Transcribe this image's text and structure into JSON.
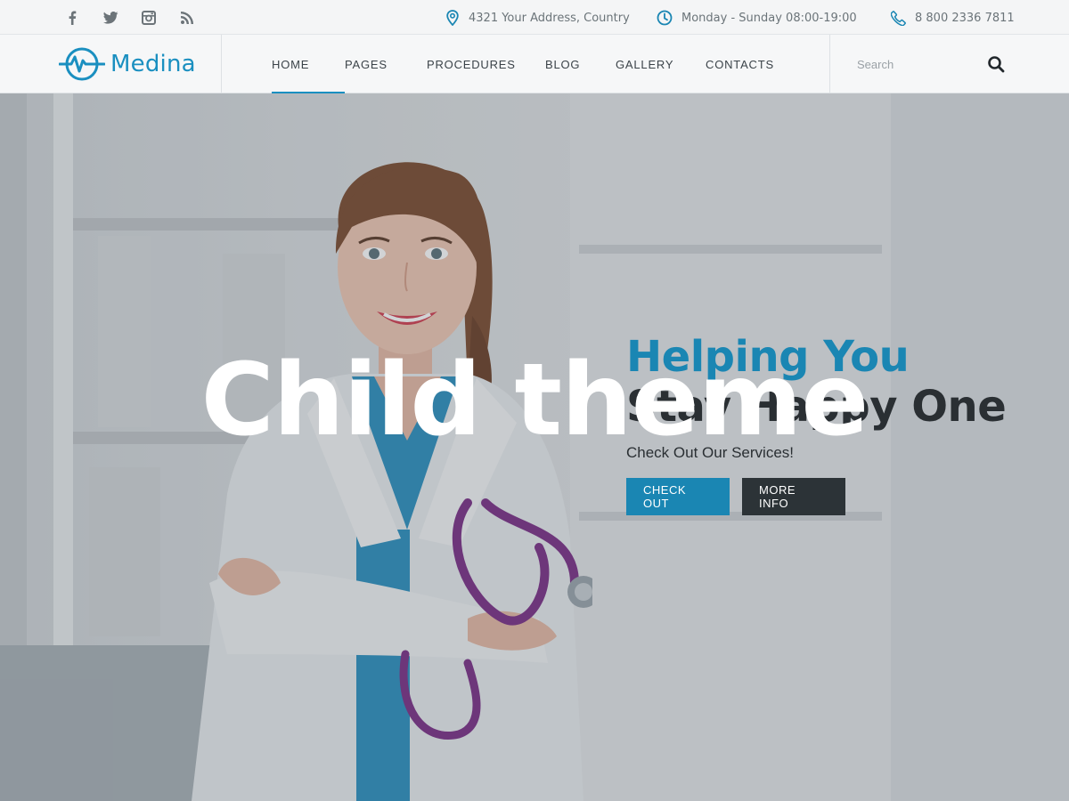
{
  "topbar": {
    "social": [
      "facebook-icon",
      "twitter-icon",
      "instagram-icon",
      "rss-icon"
    ],
    "address": "4321 Your Address, Country",
    "hours": "Monday - Sunday 08:00-19:00",
    "phone": "8 800 2336 7811"
  },
  "header": {
    "logo_text": "Medina",
    "nav": [
      "HOME",
      "PAGES",
      "PROCEDURES",
      "BLOG",
      "GALLERY",
      "CONTACTS"
    ],
    "active_nav": "HOME",
    "search_placeholder": "Search"
  },
  "hero": {
    "title_line1": "Helping You",
    "title_line2": "Stay Happy One",
    "subtitle": "Check Out Our Services!",
    "btn_primary": "CHECK OUT",
    "btn_secondary": "MORE INFO"
  },
  "overlay": {
    "label": "Child theme"
  },
  "colors": {
    "accent": "#1a86b3",
    "dark": "#2c3337",
    "topbar_bg": "#f4f5f6"
  }
}
